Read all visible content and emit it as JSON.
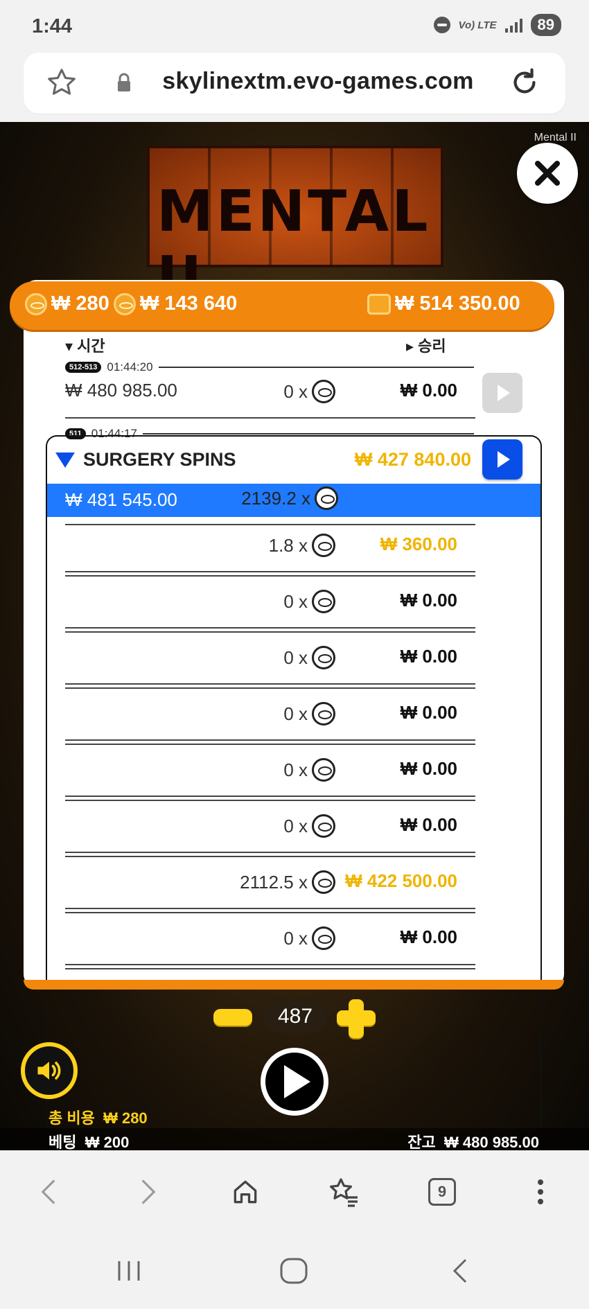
{
  "status_bar": {
    "time": "1:44",
    "volte": "Vo) LTE",
    "lte": "LTE",
    "battery": "89"
  },
  "url_bar": {
    "url": "skylinextm.evo-games.com"
  },
  "game": {
    "title_small": "Mental II",
    "logo_text": "MENTAL II",
    "header": {
      "cost": "₩ 280",
      "bonus_price": "₩ 143 640",
      "balance": "₩ 514 350.00"
    },
    "columns": {
      "time": "시간",
      "win": "승리"
    },
    "round1": {
      "badge": "512-513",
      "time": "01:44:20",
      "amount": "₩ 480 985.00",
      "mult": "0 x",
      "win": "₩ 0.00"
    },
    "round2": {
      "badge": "511",
      "time": "01:44:17",
      "bonus_title": "SURGERY SPINS",
      "bonus_total": "₩ 427 840.00",
      "highlight": {
        "amount": "₩ 481 545.00",
        "mult": "2139.2 x"
      },
      "spins": [
        {
          "mult": "1.8 x",
          "win": "₩ 360.00",
          "gold": true
        },
        {
          "mult": "0 x",
          "win": "₩ 0.00",
          "gold": false
        },
        {
          "mult": "0 x",
          "win": "₩ 0.00",
          "gold": false
        },
        {
          "mult": "0 x",
          "win": "₩ 0.00",
          "gold": false
        },
        {
          "mult": "0 x",
          "win": "₩ 0.00",
          "gold": false
        },
        {
          "mult": "0 x",
          "win": "₩ 0.00",
          "gold": false
        },
        {
          "mult": "2112.5 x",
          "win": "₩ 422 500.00",
          "gold": true
        },
        {
          "mult": "0 x",
          "win": "₩ 0.00",
          "gold": false
        }
      ]
    },
    "controls": {
      "spin_count": "487",
      "total_cost_label": "총 비용",
      "total_cost": "₩ 280",
      "bet_label": "베팅",
      "bet": "₩ 200",
      "balance_label": "잔고",
      "balance": "₩ 480 985.00"
    }
  },
  "browser_nav": {
    "tabs_count": "9"
  }
}
